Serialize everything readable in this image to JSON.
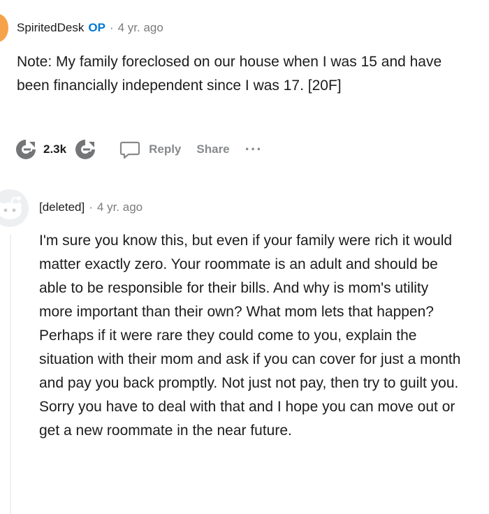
{
  "comments": [
    {
      "author": "SpiritedDesk",
      "badge": "OP",
      "separator": "·",
      "time": "4 yr. ago",
      "body": "Note: My family foreclosed on our house when I was 15 and have been financially independent since I was 17. [20F]",
      "score": "2.3k",
      "actions": {
        "reply": "Reply",
        "share": "Share",
        "more": "···"
      },
      "avatar_color": "#f6a24a"
    },
    {
      "author": "[deleted]",
      "separator": "·",
      "time": "4 yr. ago",
      "body": "I'm sure you know this, but even if your family were rich it would matter exactly zero. Your roommate is an adult and should be able to be responsible for their bills. And why is mom's utility more important than their own? What mom lets that happen? Perhaps if it were rare they could come to you, explain the situation with their mom and ask if you can cover for just a month and pay you back promptly. Not just not pay, then try to guilt you. Sorry you have to deal with that and I hope you can move out or get a new roommate in the near future."
    }
  ],
  "colors": {
    "op_badge": "#0079d3",
    "meta_gray": "#7c7c7c",
    "action_gray": "#878a8c",
    "vote_gray": "#737577"
  }
}
